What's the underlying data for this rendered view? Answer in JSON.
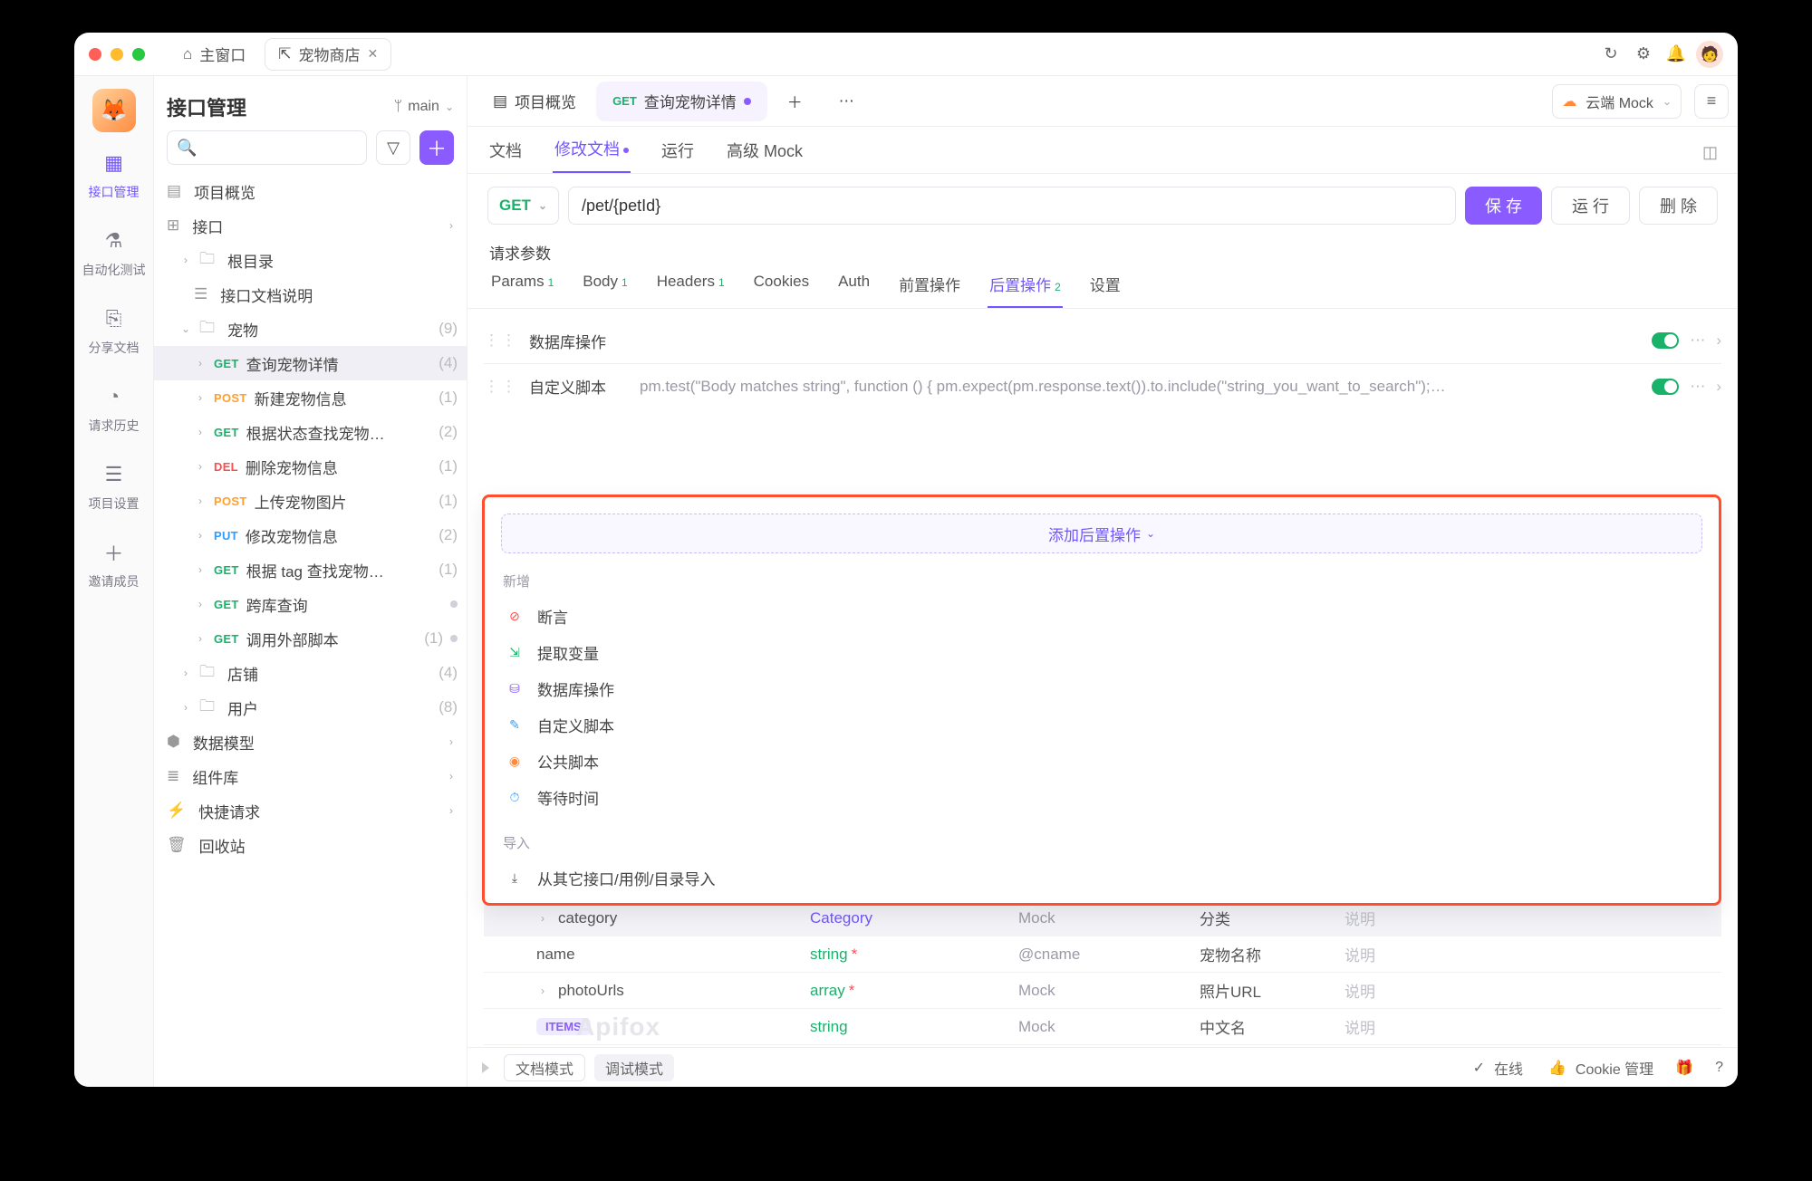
{
  "window": {
    "tabs": [
      {
        "icon": "⌂",
        "label": "主窗口"
      },
      {
        "icon": "⇱",
        "label": "宠物商店"
      }
    ]
  },
  "titlebar_icons": [
    "↻",
    "⚙",
    "🔔"
  ],
  "avatar_emoji": "🧑",
  "rail": [
    {
      "icon": "▦",
      "label": "接口管理",
      "active": true
    },
    {
      "icon": "⚗",
      "label": "自动化测试"
    },
    {
      "icon": "⎘",
      "label": "分享文档"
    },
    {
      "icon": "◔",
      "label": "请求历史"
    },
    {
      "icon": "☰",
      "label": "项目设置"
    },
    {
      "icon": "＋",
      "label": "邀请成员"
    }
  ],
  "sidebar": {
    "title": "接口管理",
    "branch_icon": "ᛘ",
    "branch": "main",
    "search_placeholder": "",
    "filter_icon": "▽",
    "add_icon": "＋",
    "tree": [
      {
        "lvl": 0,
        "type": "plain",
        "icon": "▤",
        "label": "项目概览"
      },
      {
        "lvl": 0,
        "type": "plain",
        "icon": "⊞",
        "label": "接口",
        "caret": "›"
      },
      {
        "lvl": 1,
        "type": "folder",
        "icon": "🗀",
        "label": "根目录"
      },
      {
        "lvl": 2,
        "type": "plain",
        "icon": "☰",
        "label": "接口文档说明"
      },
      {
        "lvl": 1,
        "type": "folder",
        "icon": "🗀",
        "label": "宠物",
        "count": "(9)",
        "expanded": true
      },
      {
        "lvl": 2,
        "type": "api",
        "method": "GET",
        "mclass": "m-get",
        "label": "查询宠物详情",
        "count": "(4)",
        "selected": true
      },
      {
        "lvl": 2,
        "type": "api",
        "method": "POST",
        "mclass": "m-post",
        "label": "新建宠物信息",
        "count": "(1)"
      },
      {
        "lvl": 2,
        "type": "api",
        "method": "GET",
        "mclass": "m-get",
        "label": "根据状态查找宠物…",
        "count": "(2)"
      },
      {
        "lvl": 2,
        "type": "api",
        "method": "DEL",
        "mclass": "m-del",
        "label": "删除宠物信息",
        "count": "(1)"
      },
      {
        "lvl": 2,
        "type": "api",
        "method": "POST",
        "mclass": "m-post",
        "label": "上传宠物图片",
        "count": "(1)"
      },
      {
        "lvl": 2,
        "type": "api",
        "method": "PUT",
        "mclass": "m-put",
        "label": "修改宠物信息",
        "count": "(2)"
      },
      {
        "lvl": 2,
        "type": "api",
        "method": "GET",
        "mclass": "m-get",
        "label": "根据 tag 查找宠物…",
        "count": "(1)"
      },
      {
        "lvl": 2,
        "type": "api",
        "method": "GET",
        "mclass": "m-get",
        "label": "跨库查询",
        "dot": true
      },
      {
        "lvl": 2,
        "type": "api",
        "method": "GET",
        "mclass": "m-get",
        "label": "调用外部脚本",
        "count": "(1)",
        "dot": true
      },
      {
        "lvl": 1,
        "type": "folder",
        "icon": "🗀",
        "label": "店铺",
        "count": "(4)"
      },
      {
        "lvl": 1,
        "type": "folder",
        "icon": "🗀",
        "label": "用户",
        "count": "(8)"
      },
      {
        "lvl": 0,
        "type": "plain",
        "icon": "⬢",
        "label": "数据模型",
        "caret": "›"
      },
      {
        "lvl": 0,
        "type": "plain",
        "icon": "≣",
        "label": "组件库",
        "caret": "›"
      },
      {
        "lvl": 0,
        "type": "plain",
        "icon": "⚡",
        "label": "快捷请求",
        "caret": "›"
      },
      {
        "lvl": 0,
        "type": "plain",
        "icon": "🗑",
        "label": "回收站"
      }
    ]
  },
  "editor": {
    "toptabs": {
      "overview": {
        "icon": "▤",
        "label": "项目概览"
      },
      "api": {
        "method": "GET",
        "label": "查询宠物详情"
      },
      "plus": "＋",
      "more": "⋯",
      "mock_cloud_icon": "☁",
      "mock_label": "云端 Mock",
      "menu_icon": "≡"
    },
    "subtabs": [
      "文档",
      "修改文档",
      "运行",
      "高级 Mock"
    ],
    "subtab_active_index": 1,
    "method": "GET",
    "url": "/pet/{petId}",
    "btn_save": "保 存",
    "btn_run": "运 行",
    "btn_delete": "删 除",
    "section_requestparams": "请求参数",
    "ptabs": [
      {
        "label": "Params",
        "badge": "1"
      },
      {
        "label": "Body",
        "badge": "1"
      },
      {
        "label": "Headers",
        "badge": "1"
      },
      {
        "label": "Cookies"
      },
      {
        "label": "Auth"
      },
      {
        "label": "前置操作"
      },
      {
        "label": "后置操作",
        "badge": "2",
        "active": true
      },
      {
        "label": "设置"
      }
    ],
    "ops": [
      {
        "label": "数据库操作",
        "snippet": ""
      },
      {
        "label": "自定义脚本",
        "snippet": "pm.test(\"Body matches string\", function () { pm.expect(pm.response.text()).to.include(\"string_you_want_to_search\");…"
      }
    ],
    "popover": {
      "add_label": "添加后置操作",
      "section_new": "新增",
      "items_new": [
        {
          "ic": "⊘",
          "cls": "ic-assert",
          "label": "断言"
        },
        {
          "ic": "⇲",
          "cls": "ic-extract",
          "label": "提取变量"
        },
        {
          "ic": "⛁",
          "cls": "ic-db",
          "label": "数据库操作"
        },
        {
          "ic": "✎",
          "cls": "ic-script",
          "label": "自定义脚本"
        },
        {
          "ic": "◉",
          "cls": "ic-public",
          "label": "公共脚本"
        },
        {
          "ic": "⏱",
          "cls": "ic-wait",
          "label": "等待时间"
        }
      ],
      "section_import": "导入",
      "items_import": [
        {
          "ic": "⤓",
          "cls": "ic-import",
          "label": "从其它接口/用例/目录导入"
        }
      ]
    },
    "schema": [
      {
        "name": "category",
        "chev": true,
        "type": "Category",
        "type_link": true,
        "mock": "Mock",
        "desc": "分类",
        "note": "说明",
        "hdr": true
      },
      {
        "name": "name",
        "type": "string",
        "req": true,
        "mock": "@cname",
        "desc": "宠物名称",
        "note": "说明"
      },
      {
        "name": "photoUrls",
        "chev": true,
        "type": "array",
        "req": true,
        "mock": "Mock",
        "desc": "照片URL",
        "note": "说明"
      },
      {
        "name": "ITEMS",
        "pill": true,
        "type": "string",
        "mock": "Mock",
        "desc": "中文名",
        "note": "说明"
      }
    ]
  },
  "statusbar": {
    "mode_doc": "文档模式",
    "mode_debug": "调试模式",
    "online_icon": "✓",
    "online": "在线",
    "cookie_icon": "👍",
    "cookie": "Cookie 管理",
    "gift": "🎁",
    "help": "?"
  },
  "watermark": "Apifox"
}
